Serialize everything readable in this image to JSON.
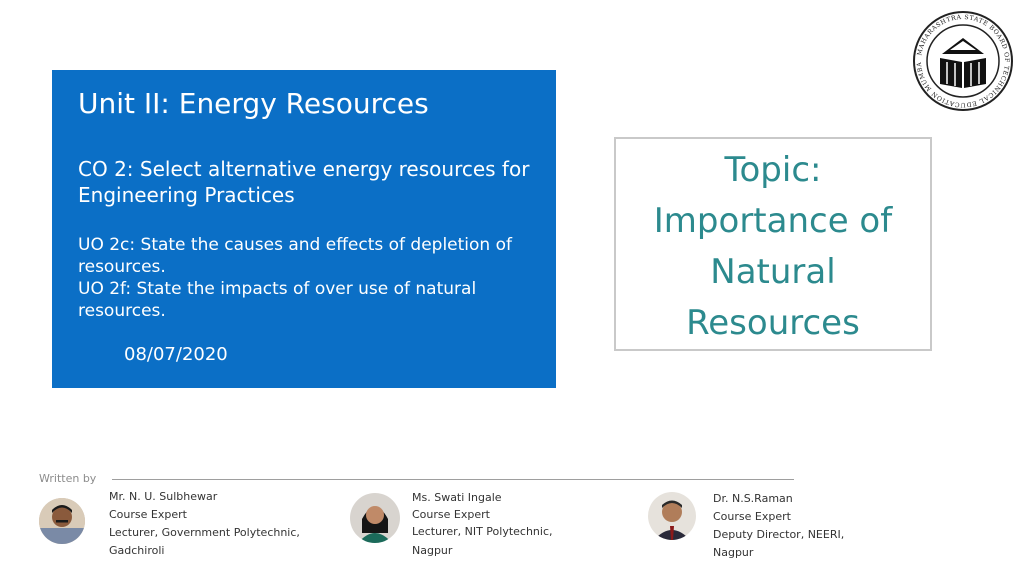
{
  "slide": {
    "unit_title": "Unit II: Energy Resources",
    "co": "CO 2: Select alternative energy resources for Engineering Practices",
    "uo_lines": [
      "UO 2c: State the causes and effects of depletion of resources.",
      "UO 2f:  State the impacts of over use of natural resources."
    ],
    "date": "08/07/2020",
    "topic": "Topic: Importance of Natural Resources",
    "written_by": "Written by",
    "authors": [
      {
        "name": "Mr. N. U. Sulbhewar",
        "role": "Course Expert",
        "org_lines": [
          "Lecturer, Government Polytechnic,",
          "Gadchiroli"
        ]
      },
      {
        "name": "Ms. Swati Ingale",
        "role": "Course Expert",
        "org_lines": [
          "Lecturer, NIT Polytechnic,",
          "Nagpur"
        ]
      },
      {
        "name": "Dr. N.S.Raman",
        "role": "Course Expert",
        "org_lines": [
          "Deputy Director, NEERI,",
          "Nagpur"
        ]
      }
    ]
  },
  "logo": {
    "text": "MAHARASHTRA STATE BOARD OF TECHNICAL EDUCATION MUMBAI"
  },
  "colors": {
    "panel_blue": "#0b6fc6",
    "topic_teal": "#2c8a8e"
  }
}
